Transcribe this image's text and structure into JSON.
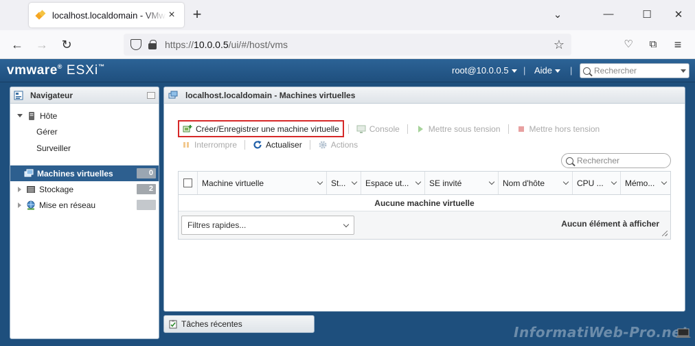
{
  "browser": {
    "tab_title": "localhost.localdomain - VMware ESXi",
    "url_prefix": "https://",
    "url_host": "10.0.0.5",
    "url_path": "/ui/#/host/vms"
  },
  "header": {
    "brand": "vmware",
    "product": "ESXi",
    "user": "root@10.0.0.5",
    "help": "Aide",
    "search_placeholder": "Rechercher"
  },
  "navigator": {
    "title": "Navigateur",
    "host_label": "Hôte",
    "host_children": [
      "Gérer",
      "Surveiller"
    ],
    "items": [
      {
        "label": "Machines virtuelles",
        "badge": "0"
      },
      {
        "label": "Stockage",
        "badge": "2"
      },
      {
        "label": "Mise en réseau",
        "badge": ""
      }
    ]
  },
  "main": {
    "title": "localhost.localdomain - Machines virtuelles",
    "toolbar": {
      "create": "Créer/Enregistrer une machine virtuelle",
      "console": "Console",
      "power_on": "Mettre sous tension",
      "power_off": "Mettre hors tension",
      "suspend": "Interrompre",
      "refresh": "Actualiser",
      "actions": "Actions"
    },
    "search_placeholder": "Rechercher",
    "columns": [
      "Machine virtuelle",
      "St...",
      "Espace ut...",
      "SE invité",
      "Nom d'hôte",
      "CPU ...",
      "Mémo..."
    ],
    "empty_message": "Aucune machine virtuelle",
    "quick_filter": "Filtres rapides...",
    "no_items": "Aucun élément à afficher"
  },
  "tasks": {
    "label": "Tâches récentes"
  },
  "watermark": "InformatiWeb-Pro.net",
  "colors": {
    "header_blue": "#2c6396",
    "selected_blue": "#2d5f8f",
    "highlight_red": "#d62828"
  }
}
